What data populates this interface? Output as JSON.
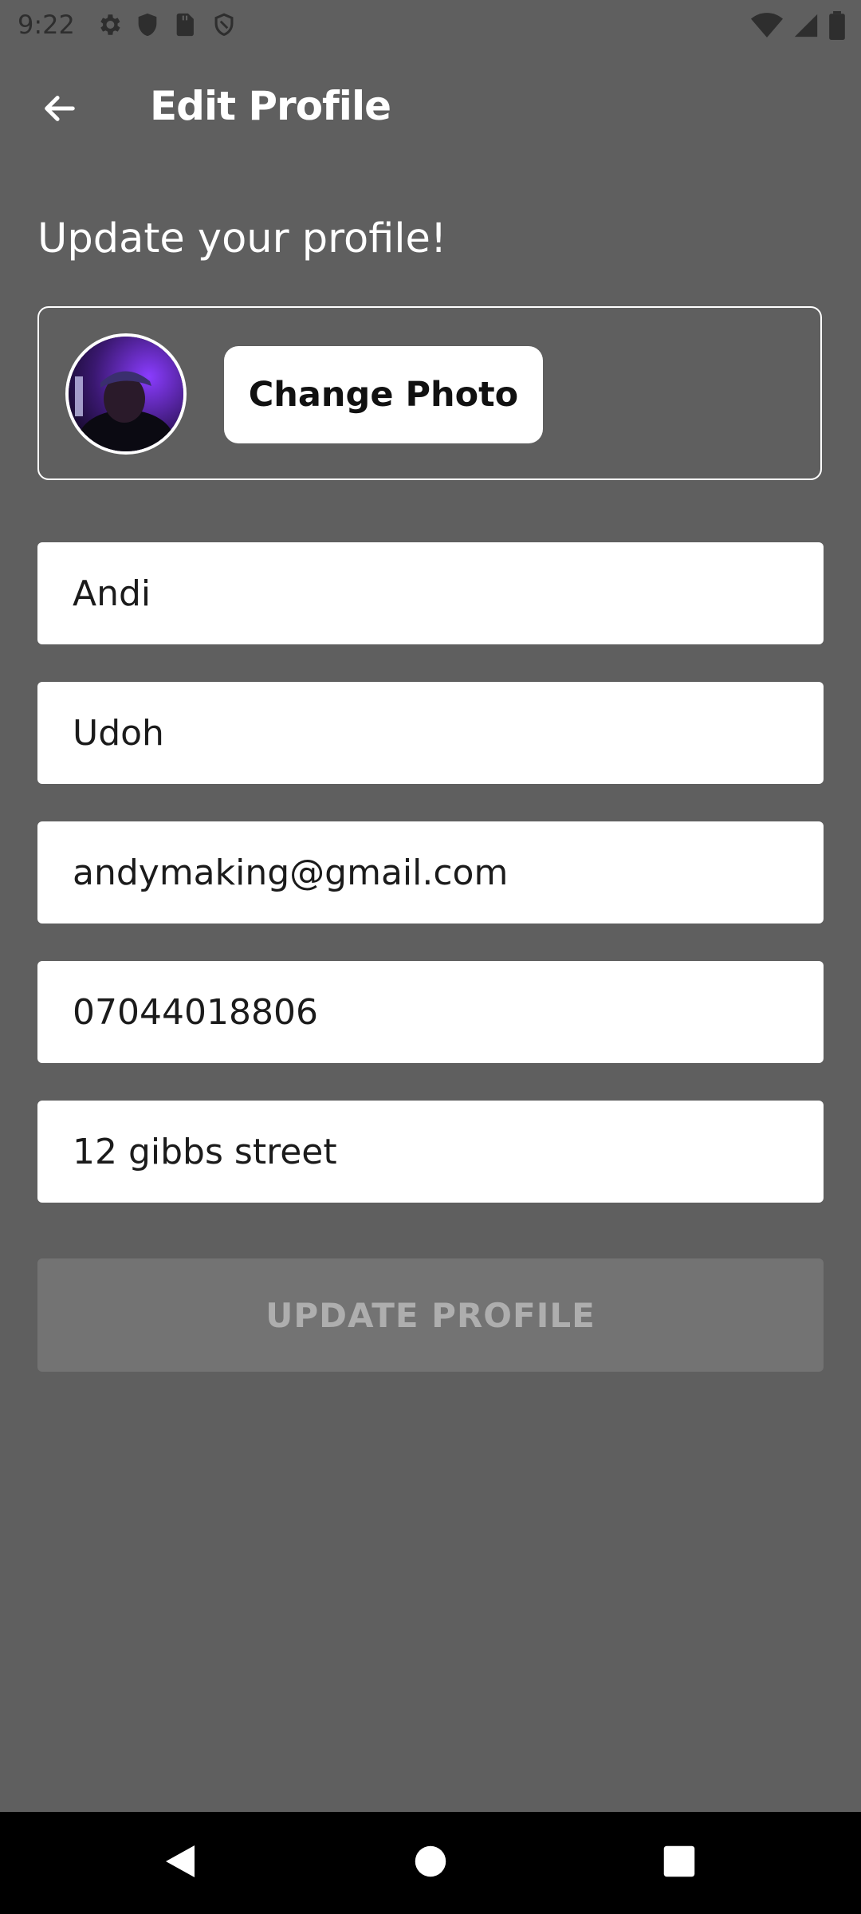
{
  "status_bar": {
    "time": "9:22",
    "left_icons": [
      "gear-icon",
      "shield-icon",
      "sd-card-icon",
      "shield-outline-icon"
    ],
    "right_icons": [
      "wifi-icon",
      "signal-icon",
      "battery-icon"
    ]
  },
  "app_bar": {
    "back_icon": "arrow-left-icon",
    "title": "Edit Profile"
  },
  "main": {
    "heading": "Update your profile!",
    "photo_card": {
      "change_photo_label": "Change Photo"
    },
    "fields": {
      "first_name": "Andi",
      "last_name": "Udoh",
      "email": "andymaking@gmail.com",
      "phone": "07044018806",
      "address": "12 gibbs street"
    },
    "update_button_label": "UPDATE PROFILE"
  },
  "nav_bar": {
    "icons": [
      "nav-back-icon",
      "nav-home-icon",
      "nav-recents-icon"
    ]
  },
  "colors": {
    "background": "#5f5f5f",
    "disabled_button": "#737373",
    "disabled_text": "#aeaeae"
  }
}
